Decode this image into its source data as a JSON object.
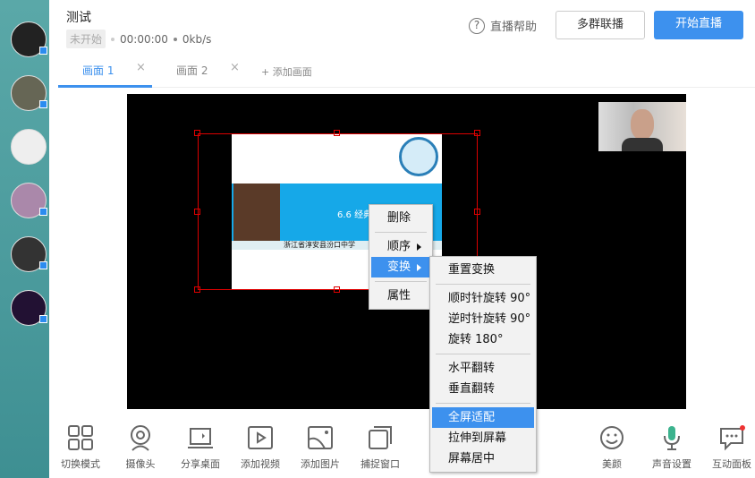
{
  "header": {
    "title": "测试",
    "status_badge": "未开始",
    "time": "00:00:00",
    "bitrate": "0kb/s",
    "help_label": "直播帮助",
    "multi_button": "多群联播",
    "start_button": "开始直播"
  },
  "tabs": [
    {
      "label": "画面 1"
    },
    {
      "label": "画面 2"
    }
  ],
  "add_scene": "添加画面",
  "close_glyph": "×",
  "slide": {
    "title": "6.6 经典",
    "school": "浙江省淳安县汾口中学"
  },
  "context_menu": {
    "items": [
      "删除",
      "顺序",
      "变换",
      "属性"
    ]
  },
  "submenu": {
    "items": [
      "重置变换",
      "顺时针旋转 90°",
      "逆时针旋转 90°",
      "旋转 180°",
      "水平翻转",
      "垂直翻转",
      "全屏适配",
      "拉伸到屏幕",
      "屏幕居中"
    ]
  },
  "toolbar": {
    "left": [
      "切换模式",
      "摄像头",
      "分享桌面",
      "添加视频",
      "添加图片",
      "捕捉窗口"
    ],
    "right": [
      "美颜",
      "声音设置",
      "互动面板"
    ]
  },
  "colors": {
    "accent": "#3d91ee",
    "selection": "#dd0000"
  }
}
